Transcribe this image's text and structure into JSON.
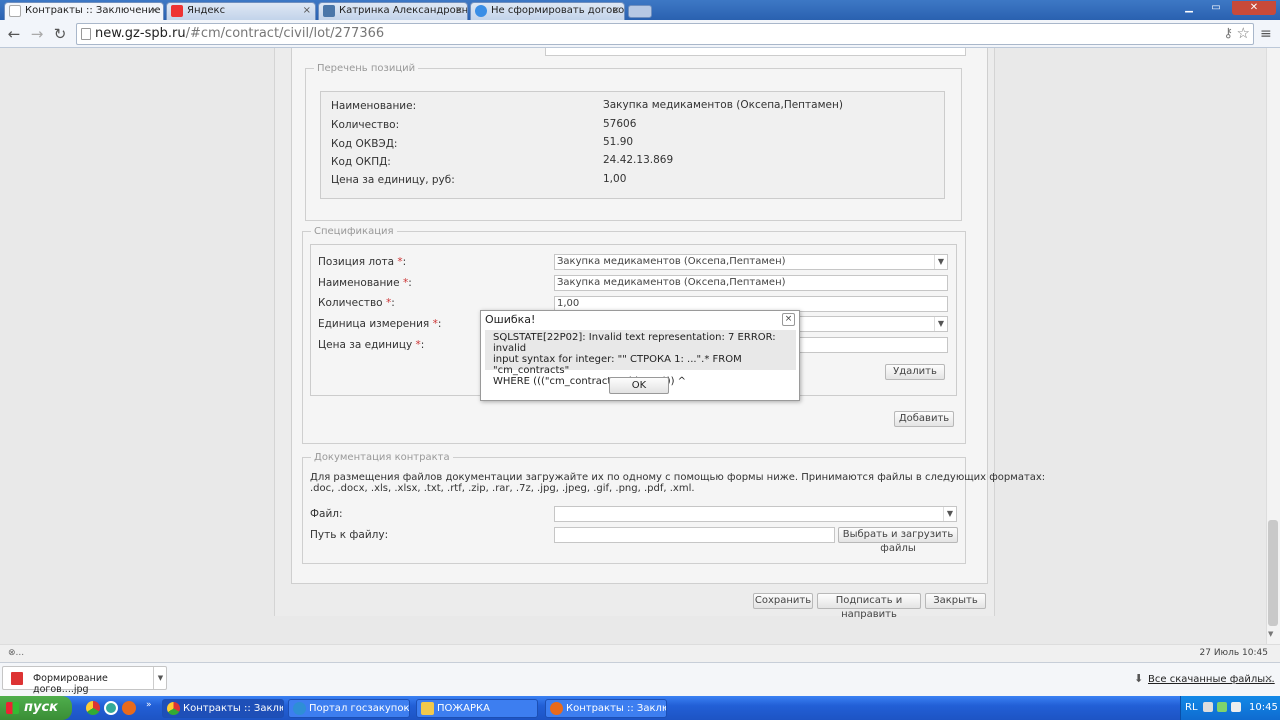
{
  "browser": {
    "tabs": [
      {
        "label": "Контракты :: Заключение",
        "close": "×"
      },
      {
        "label": "Яндекс",
        "close": "×"
      },
      {
        "label": "Катринка Александровна",
        "close": "×"
      },
      {
        "label": "Не сформировать договор",
        "close": "×"
      }
    ],
    "url_host": "new.gz-spb.ru",
    "url_path": "/#cm/contract/civil/lot/277366"
  },
  "positions": {
    "legend": "Перечень позиций",
    "rows": [
      {
        "label": "Наименование:",
        "value": "Закупка медикаментов (Оксепа,Пептамен)"
      },
      {
        "label": "Количество:",
        "value": "57606"
      },
      {
        "label": "Код ОКВЭД:",
        "value": "51.90"
      },
      {
        "label": "Код ОКПД:",
        "value": "24.42.13.869"
      },
      {
        "label": "Цена за единицу, руб:",
        "value": "1,00"
      }
    ]
  },
  "spec": {
    "legend": "Спецификация",
    "required_mark": "*",
    "position_label": "Позиция лота",
    "position_value": "Закупка медикаментов (Оксепа,Пептамен)",
    "name_label": "Наименование",
    "name_value": "Закупка медикаментов (Оксепа,Пептамен)",
    "qty_label": "Количество",
    "qty_value": "1,00",
    "unit_label": "Единица измерения",
    "price_label": "Цена за единицу",
    "delete_button": "Удалить",
    "add_button": "Добавить"
  },
  "docs": {
    "legend": "Документация контракта",
    "note_line1": "Для размещения файлов документации загружайте их по одному с помощью формы ниже. Принимаются файлы в следующих форматах:",
    "note_line2": ".doc, .docx, .xls, .xlsx, .txt, .rtf, .zip, .rar, .7z, .jpg, .jpeg, .gif, .png, .pdf, .xml.",
    "file_label": "Файл:",
    "path_label": "Путь к файлу:",
    "browse_button": "Выбрать и загрузить файлы"
  },
  "footer_buttons": {
    "save": "Сохранить",
    "sign": "Подписать и направить",
    "close": "Закрыть"
  },
  "dialog": {
    "title": "Ошибка!",
    "close": "×",
    "message_line1": "SQLSTATE[22P02]: Invalid text representation: 7 ERROR: invalid",
    "message_line2": "input syntax for integer: \"\" СТРОКА 1: ...\".* FROM \"cm_contracts\"",
    "message_line3": "WHERE (((\"cm_contracts\".\"id\" = ''))) ^",
    "ok": "OK"
  },
  "status": {
    "left": "⊗...",
    "right": "27 Июль 10:45"
  },
  "downloads": {
    "file": "Формирование догов....jpg",
    "all": "Все скачанные файлы...",
    "close": "×"
  },
  "taskbar": {
    "start": "пуск",
    "tasks": [
      "Контракты :: Заклю...",
      "Портал госзакупок -...",
      "ПОЖАРКА",
      "Контракты :: Заклю..."
    ],
    "lang": "RL",
    "clock": "10:45"
  },
  "colors": {
    "required": "#cc3333",
    "taskbar": "#225fd6",
    "tab_strip": "#2a61b0"
  }
}
